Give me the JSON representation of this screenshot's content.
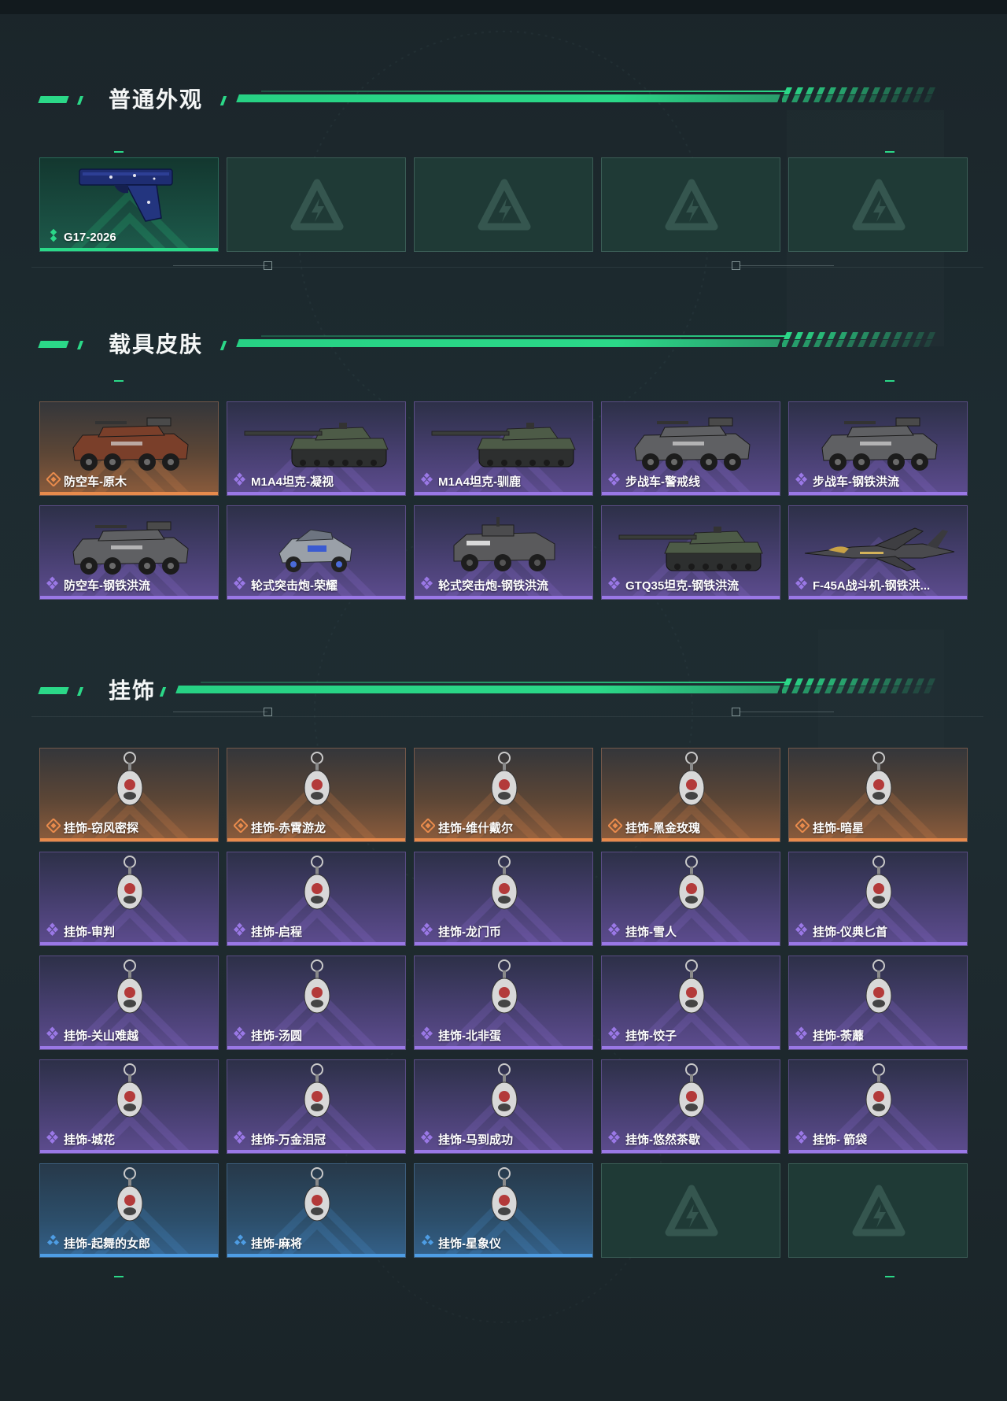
{
  "colors": {
    "accent": "#2bd888",
    "green_rarity": "#2bd888",
    "orange_rarity": "#e88b4c",
    "purple_rarity": "#9a78e6",
    "blue_rarity": "#4e9de4"
  },
  "sections": [
    {
      "title": "普通外观",
      "items": [
        {
          "label": "G17-2026",
          "rarity": "green",
          "icon": "pistol"
        },
        {
          "label": "",
          "rarity": "empty"
        },
        {
          "label": "",
          "rarity": "empty"
        },
        {
          "label": "",
          "rarity": "empty"
        },
        {
          "label": "",
          "rarity": "empty"
        }
      ]
    },
    {
      "title": "载具皮肤",
      "items": [
        {
          "label": "防空车-原木",
          "rarity": "orange",
          "icon": "armored-vehicle"
        },
        {
          "label": "M1A4坦克-凝视",
          "rarity": "purple",
          "icon": "tank"
        },
        {
          "label": "M1A4坦克-驯鹿",
          "rarity": "purple",
          "icon": "tank"
        },
        {
          "label": "步战车-警戒线",
          "rarity": "purple",
          "icon": "armored-vehicle"
        },
        {
          "label": "步战车-钢铁洪流",
          "rarity": "purple",
          "icon": "armored-vehicle"
        },
        {
          "label": "防空车-钢铁洪流",
          "rarity": "purple",
          "icon": "armored-vehicle"
        },
        {
          "label": "轮式突击炮-荣耀",
          "rarity": "purple",
          "icon": "buggy"
        },
        {
          "label": "轮式突击炮-钢铁洪流",
          "rarity": "purple",
          "icon": "armored-car"
        },
        {
          "label": "GTQ35坦克-钢铁洪流",
          "rarity": "purple",
          "icon": "tank"
        },
        {
          "label": "F-45A战斗机-钢铁洪...",
          "rarity": "purple",
          "icon": "jet"
        }
      ]
    },
    {
      "title": "挂饰",
      "items": [
        {
          "label": "挂饰-窃风密探",
          "rarity": "orange",
          "icon": "charm"
        },
        {
          "label": "挂饰-赤霄游龙",
          "rarity": "orange",
          "icon": "charm"
        },
        {
          "label": "挂饰-维什戴尔",
          "rarity": "orange",
          "icon": "charm"
        },
        {
          "label": "挂饰-黑金玫瑰",
          "rarity": "orange",
          "icon": "charm"
        },
        {
          "label": "挂饰-暗星",
          "rarity": "orange",
          "icon": "charm"
        },
        {
          "label": "挂饰-审判",
          "rarity": "purple",
          "icon": "charm"
        },
        {
          "label": "挂饰-启程",
          "rarity": "purple",
          "icon": "charm"
        },
        {
          "label": "挂饰-龙门币",
          "rarity": "purple",
          "icon": "charm"
        },
        {
          "label": "挂饰-雪人",
          "rarity": "purple",
          "icon": "charm"
        },
        {
          "label": "挂饰-仪典匕首",
          "rarity": "purple",
          "icon": "charm"
        },
        {
          "label": "挂饰-关山难越",
          "rarity": "purple",
          "icon": "charm"
        },
        {
          "label": "挂饰-汤圆",
          "rarity": "purple",
          "icon": "charm"
        },
        {
          "label": "挂饰-北非蛋",
          "rarity": "purple",
          "icon": "charm"
        },
        {
          "label": "挂饰-饺子",
          "rarity": "purple",
          "icon": "charm"
        },
        {
          "label": "挂饰-荼蘼",
          "rarity": "purple",
          "icon": "charm"
        },
        {
          "label": "挂饰-城花",
          "rarity": "purple",
          "icon": "charm"
        },
        {
          "label": "挂饰-万金泪冠",
          "rarity": "purple",
          "icon": "charm"
        },
        {
          "label": "挂饰-马到成功",
          "rarity": "purple",
          "icon": "charm"
        },
        {
          "label": "挂饰-悠然茶歇",
          "rarity": "purple",
          "icon": "charm"
        },
        {
          "label": "挂饰- 箭袋",
          "rarity": "purple",
          "icon": "charm"
        },
        {
          "label": "挂饰-起舞的女郎",
          "rarity": "blue",
          "icon": "charm"
        },
        {
          "label": "挂饰-麻将",
          "rarity": "blue",
          "icon": "charm"
        },
        {
          "label": "挂饰-星象仪",
          "rarity": "blue",
          "icon": "charm"
        },
        {
          "label": "",
          "rarity": "empty"
        },
        {
          "label": "",
          "rarity": "empty"
        }
      ]
    }
  ]
}
